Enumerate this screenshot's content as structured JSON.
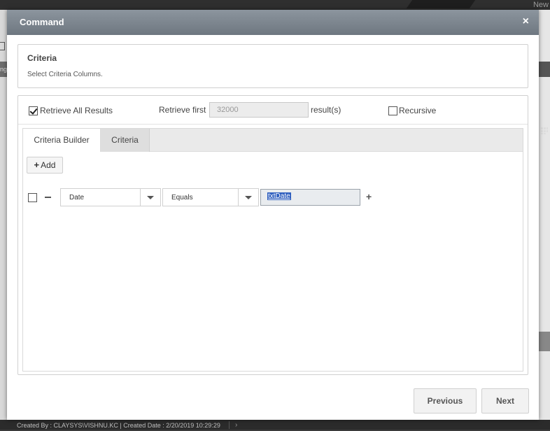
{
  "background": {
    "top_right_text": "New",
    "left_band_text": "ng",
    "footer_text": "Created By : CLAYSYS\\VISHNU.KC | Created Date : 2/20/2019 10:29:29",
    "footer_chevron": "›"
  },
  "modal": {
    "title": "Command",
    "close_glyph": "×"
  },
  "info": {
    "title": "Criteria",
    "subtitle": "Select Criteria Columns."
  },
  "options": {
    "retrieve_all_label": "Retrieve All Results",
    "retrieve_all_checked": true,
    "retrieve_first_label": "Retrieve first",
    "retrieve_first_value": "32000",
    "results_suffix": "result(s)",
    "recursive_label": "Recursive",
    "recursive_checked": false
  },
  "tabs": [
    {
      "label": "Criteria Builder",
      "active": true
    },
    {
      "label": "Criteria",
      "active": false
    }
  ],
  "builder": {
    "add_label": "Add",
    "row": {
      "column": "Date",
      "operator": "Equals",
      "value": "txtDate"
    }
  },
  "footer_buttons": {
    "previous": "Previous",
    "next": "Next"
  },
  "icons": {
    "close": "close-icon",
    "add": "plus-icon",
    "remove": "minus-icon",
    "dropdown": "chevron-down-icon"
  }
}
